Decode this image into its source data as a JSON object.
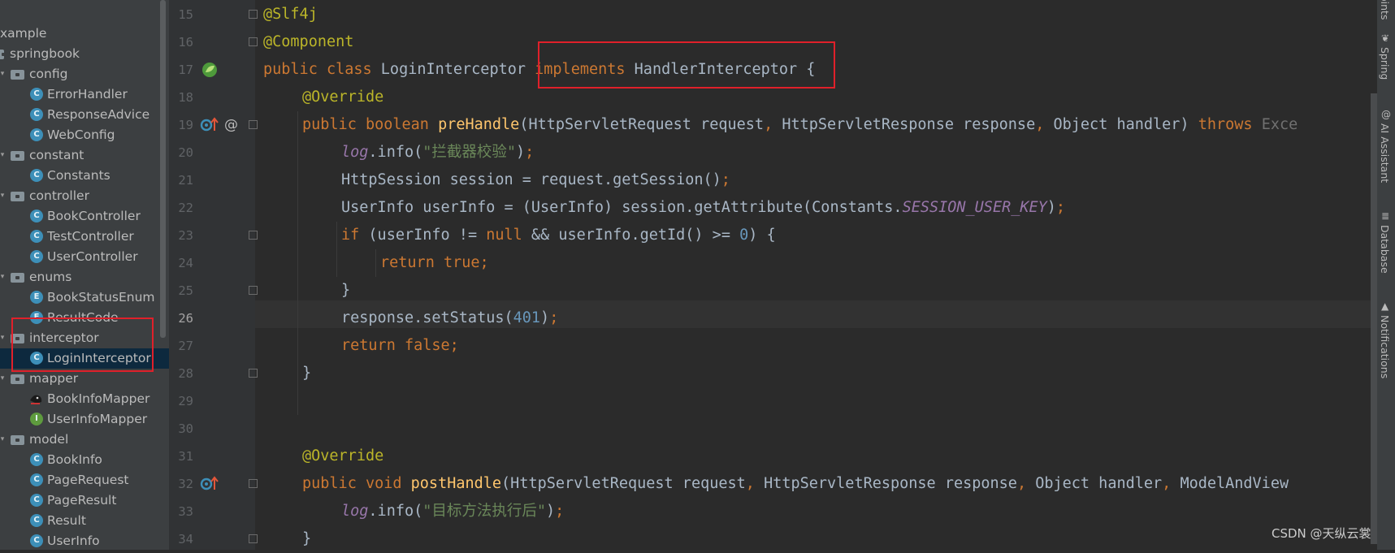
{
  "project_tree": {
    "rows": [
      {
        "label": "xample",
        "kind": "text",
        "indent": 0
      },
      {
        "label": "springbook",
        "kind": "module",
        "indent": 0
      },
      {
        "label": "config",
        "kind": "folder",
        "indent": 1
      },
      {
        "label": "ErrorHandler",
        "kind": "class",
        "indent": 2
      },
      {
        "label": "ResponseAdvice",
        "kind": "class",
        "indent": 2
      },
      {
        "label": "WebConfig",
        "kind": "class",
        "indent": 2
      },
      {
        "label": "constant",
        "kind": "folder",
        "indent": 1
      },
      {
        "label": "Constants",
        "kind": "class",
        "indent": 2
      },
      {
        "label": "controller",
        "kind": "folder",
        "indent": 1
      },
      {
        "label": "BookController",
        "kind": "class",
        "indent": 2
      },
      {
        "label": "TestController",
        "kind": "class",
        "indent": 2
      },
      {
        "label": "UserController",
        "kind": "class",
        "indent": 2
      },
      {
        "label": "enums",
        "kind": "folder",
        "indent": 1
      },
      {
        "label": "BookStatusEnum",
        "kind": "enum",
        "indent": 2
      },
      {
        "label": "ResultCode",
        "kind": "enum",
        "indent": 2
      },
      {
        "label": "interceptor",
        "kind": "folder",
        "indent": 1
      },
      {
        "label": "LoginInterceptor",
        "kind": "class",
        "indent": 2,
        "selected": true
      },
      {
        "label": "mapper",
        "kind": "folder",
        "indent": 1
      },
      {
        "label": "BookInfoMapper",
        "kind": "mapper",
        "indent": 2
      },
      {
        "label": "UserInfoMapper",
        "kind": "iface",
        "indent": 2
      },
      {
        "label": "model",
        "kind": "folder",
        "indent": 1
      },
      {
        "label": "BookInfo",
        "kind": "class",
        "indent": 2
      },
      {
        "label": "PageRequest",
        "kind": "class",
        "indent": 2
      },
      {
        "label": "PageResult",
        "kind": "class",
        "indent": 2
      },
      {
        "label": "Result",
        "kind": "class",
        "indent": 2
      },
      {
        "label": "UserInfo",
        "kind": "class",
        "indent": 2
      }
    ]
  },
  "editor": {
    "current_line": 26,
    "lines": [
      {
        "num": "15",
        "indent": 0,
        "tokens": [
          {
            "t": "@Slf4j",
            "c": "ann"
          }
        ]
      },
      {
        "num": "16",
        "indent": 0,
        "tokens": [
          {
            "t": "@Component",
            "c": "ann"
          }
        ]
      },
      {
        "num": "17",
        "indent": 0,
        "tokens": [
          {
            "t": "public class",
            "c": "kw"
          },
          {
            "t": " LoginInterceptor ",
            "c": ""
          },
          {
            "t": "implements",
            "c": "kw"
          },
          {
            "t": " HandlerInterceptor {",
            "c": ""
          }
        ]
      },
      {
        "num": "18",
        "indent": 1,
        "tokens": [
          {
            "t": "@Override",
            "c": "ann"
          }
        ]
      },
      {
        "num": "19",
        "indent": 1,
        "tokens": [
          {
            "t": "public boolean ",
            "c": "kw"
          },
          {
            "t": "preHandle",
            "c": "fn"
          },
          {
            "t": "(HttpServletRequest request",
            "c": ""
          },
          {
            "t": ", ",
            "c": "kw"
          },
          {
            "t": "HttpServletResponse response",
            "c": ""
          },
          {
            "t": ", ",
            "c": "kw"
          },
          {
            "t": "Object handler) ",
            "c": ""
          },
          {
            "t": "throws ",
            "c": "kw"
          },
          {
            "t": "Exce",
            "c": "dim"
          }
        ]
      },
      {
        "num": "20",
        "indent": 2,
        "tokens": [
          {
            "t": "log",
            "c": "logv"
          },
          {
            "t": ".info(",
            "c": ""
          },
          {
            "t": "\"拦截器校验\"",
            "c": "str"
          },
          {
            "t": ")",
            "c": ""
          },
          {
            "t": ";",
            "c": "kw"
          }
        ]
      },
      {
        "num": "21",
        "indent": 2,
        "tokens": [
          {
            "t": "HttpSession session = request.getSession()",
            "c": ""
          },
          {
            "t": ";",
            "c": "kw"
          }
        ]
      },
      {
        "num": "22",
        "indent": 2,
        "tokens": [
          {
            "t": "UserInfo userInfo = (UserInfo) session.getAttribute(Constants.",
            "c": ""
          },
          {
            "t": "SESSION_USER_KEY",
            "c": "stat"
          },
          {
            "t": ")",
            "c": ""
          },
          {
            "t": ";",
            "c": "kw"
          }
        ]
      },
      {
        "num": "23",
        "indent": 2,
        "tokens": [
          {
            "t": "if ",
            "c": "kw"
          },
          {
            "t": "(userInfo != ",
            "c": ""
          },
          {
            "t": "null ",
            "c": "kw"
          },
          {
            "t": "&& userInfo.getId() >= ",
            "c": ""
          },
          {
            "t": "0",
            "c": "num"
          },
          {
            "t": ") {",
            "c": ""
          }
        ]
      },
      {
        "num": "24",
        "indent": 3,
        "tokens": [
          {
            "t": "return true;",
            "c": "kw"
          }
        ]
      },
      {
        "num": "25",
        "indent": 2,
        "tokens": [
          {
            "t": "}",
            "c": ""
          }
        ]
      },
      {
        "num": "26",
        "indent": 2,
        "tokens": [
          {
            "t": "response.setStatus(",
            "c": ""
          },
          {
            "t": "401",
            "c": "num"
          },
          {
            "t": ")",
            "c": ""
          },
          {
            "t": ";",
            "c": "kw"
          }
        ]
      },
      {
        "num": "27",
        "indent": 2,
        "tokens": [
          {
            "t": "return false;",
            "c": "kw"
          }
        ]
      },
      {
        "num": "28",
        "indent": 1,
        "tokens": [
          {
            "t": "}",
            "c": ""
          }
        ]
      },
      {
        "num": "29",
        "indent": 0,
        "tokens": []
      },
      {
        "num": "30",
        "indent": 0,
        "tokens": []
      },
      {
        "num": "31",
        "indent": 1,
        "tokens": [
          {
            "t": "@Override",
            "c": "ann"
          }
        ]
      },
      {
        "num": "32",
        "indent": 1,
        "tokens": [
          {
            "t": "public void ",
            "c": "kw"
          },
          {
            "t": "postHandle",
            "c": "fn"
          },
          {
            "t": "(HttpServletRequest request",
            "c": ""
          },
          {
            "t": ", ",
            "c": "kw"
          },
          {
            "t": "HttpServletResponse response",
            "c": ""
          },
          {
            "t": ", ",
            "c": "kw"
          },
          {
            "t": "Object handler",
            "c": ""
          },
          {
            "t": ", ",
            "c": "kw"
          },
          {
            "t": "ModelAndView",
            "c": ""
          }
        ]
      },
      {
        "num": "33",
        "indent": 2,
        "tokens": [
          {
            "t": "log",
            "c": "logv"
          },
          {
            "t": ".info(",
            "c": ""
          },
          {
            "t": "\"目标方法执行后\"",
            "c": "str"
          },
          {
            "t": ")",
            "c": ""
          },
          {
            "t": ";",
            "c": "kw"
          }
        ]
      },
      {
        "num": "34",
        "indent": 1,
        "tokens": [
          {
            "t": "}",
            "c": ""
          }
        ]
      }
    ]
  },
  "gutter_icons": [
    {
      "line": "17",
      "icons": [
        "spring-bean-icon"
      ]
    },
    {
      "line": "19",
      "icons": [
        "override-method-icon",
        "annotation-at-icon"
      ]
    },
    {
      "line": "32",
      "icons": [
        "override-method-icon"
      ]
    }
  ],
  "right_toolbar": {
    "tabs": [
      {
        "label": "oints",
        "icon": ""
      },
      {
        "label": "Spring",
        "icon": "spring-leaf-icon"
      },
      {
        "label": "AI Assistant",
        "icon": "ai-assistant-icon"
      },
      {
        "label": "Database",
        "icon": "database-icon"
      },
      {
        "label": "Notifications",
        "icon": "bell-icon"
      }
    ]
  },
  "watermark": "CSDN @天纵云裳",
  "colors": {
    "keyword": "#cc7832",
    "annotation": "#bbb529",
    "function": "#ffc66d",
    "string": "#6a8759",
    "number": "#6897bb",
    "static_field": "#9876aa",
    "default_text": "#a9b7c6",
    "highlight_box": "#e0202a",
    "selection": "#0d293e"
  }
}
